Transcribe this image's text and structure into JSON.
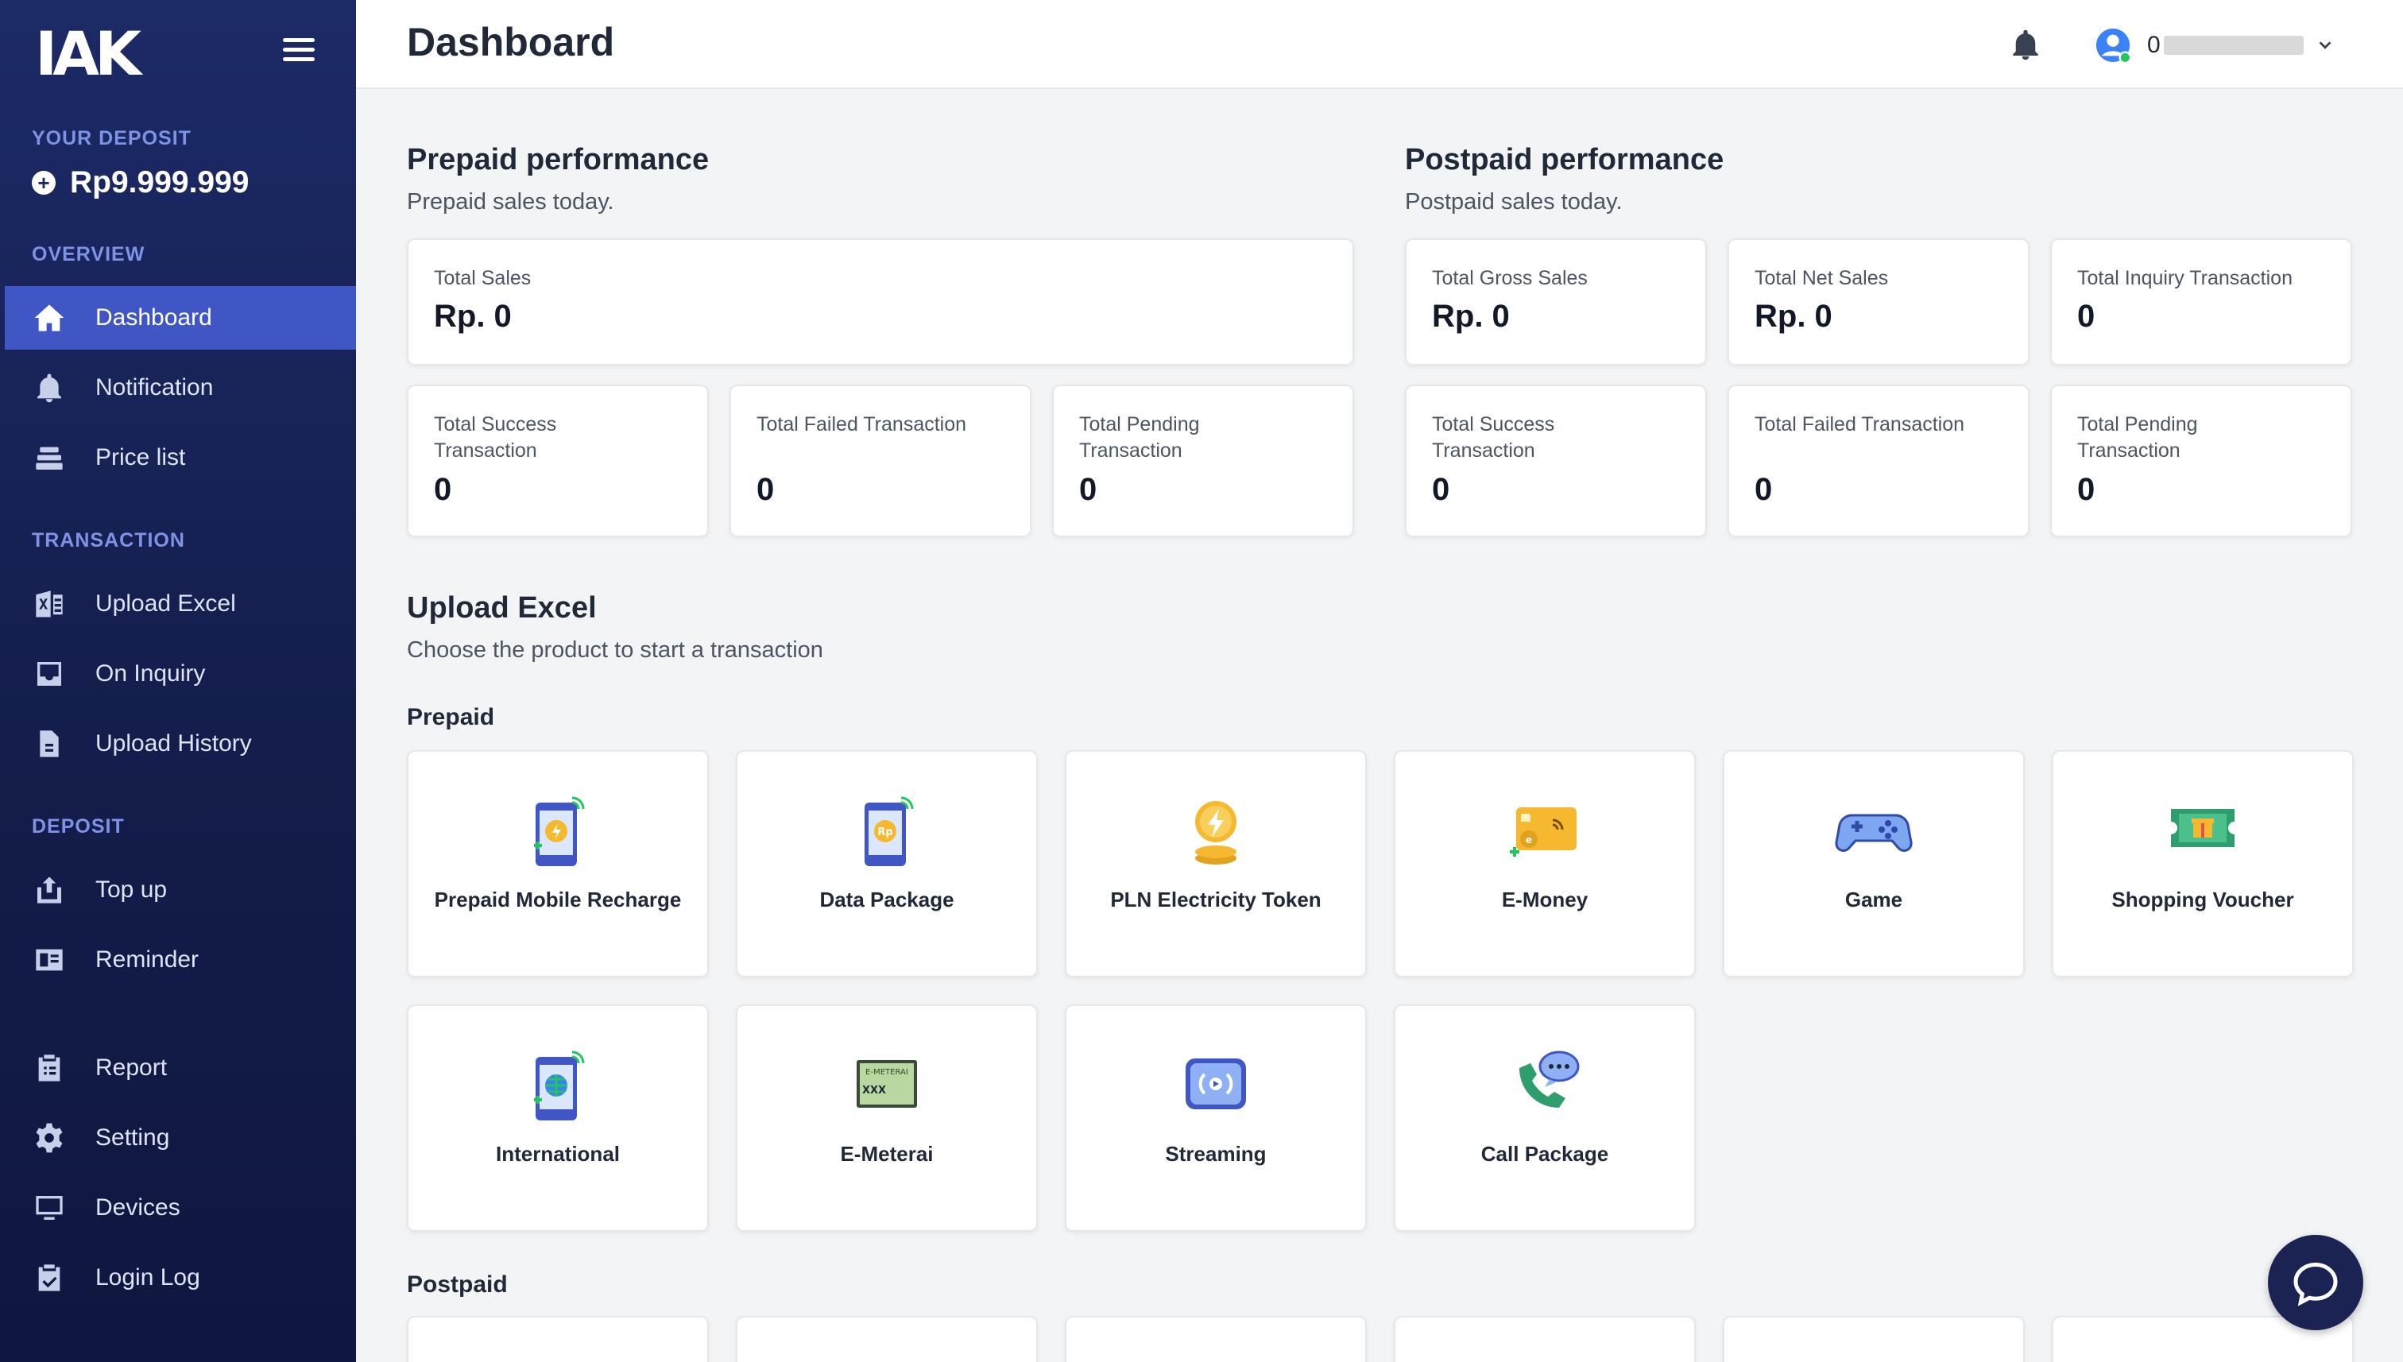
{
  "sidebar": {
    "logo": "IAK",
    "deposit_label": "YOUR DEPOSIT",
    "deposit_value": "Rp9.999.999",
    "sections": {
      "overview": "OVERVIEW",
      "transaction": "TRANSACTION",
      "deposit": "DEPOSIT"
    },
    "items": {
      "dashboard": "Dashboard",
      "notification": "Notification",
      "price_list": "Price list",
      "upload_excel": "Upload Excel",
      "on_inquiry": "On Inquiry",
      "upload_history": "Upload History",
      "top_up": "Top up",
      "reminder": "Reminder",
      "report": "Report",
      "setting": "Setting",
      "devices": "Devices",
      "login_log": "Login Log"
    }
  },
  "header": {
    "title": "Dashboard",
    "user_name_prefix": "0"
  },
  "prepaid": {
    "title": "Prepaid performance",
    "subtitle": "Prepaid sales today.",
    "total_sales_label": "Total Sales",
    "total_sales_value": "Rp. 0",
    "success_label": "Total Success Transaction",
    "success_value": "0",
    "failed_label": "Total Failed Transaction",
    "failed_value": "0",
    "pending_label": "Total Pending Transaction",
    "pending_value": "0"
  },
  "postpaid": {
    "title": "Postpaid performance",
    "subtitle": "Postpaid sales today.",
    "gross_label": "Total Gross Sales",
    "gross_value": "Rp. 0",
    "net_label": "Total Net Sales",
    "net_value": "Rp. 0",
    "inquiry_label": "Total Inquiry Transaction",
    "inquiry_value": "0",
    "success_label": "Total Success Transaction",
    "success_value": "0",
    "failed_label": "Total Failed Transaction",
    "failed_value": "0",
    "pending_label": "Total Pending Transaction",
    "pending_value": "0"
  },
  "upload": {
    "title": "Upload Excel",
    "subtitle": "Choose the product to start a transaction",
    "prepaid_label": "Prepaid",
    "postpaid_label": "Postpaid",
    "products": {
      "mobile": "Prepaid Mobile Recharge",
      "data": "Data Package",
      "pln": "PLN Electricity Token",
      "emoney": "E-Money",
      "game": "Game",
      "voucher": "Shopping Voucher",
      "international": "International",
      "emeterai": "E-Meterai",
      "streaming": "Streaming",
      "call": "Call Package"
    },
    "emeterai_icon_text": "E-METERAI",
    "emeterai_icon_code": "XXX"
  },
  "colors": {
    "sidebar_bg": "#1c2a66",
    "active_item": "#3f56c4",
    "section_label": "#7e93e6",
    "chat_button": "#1b2352"
  }
}
